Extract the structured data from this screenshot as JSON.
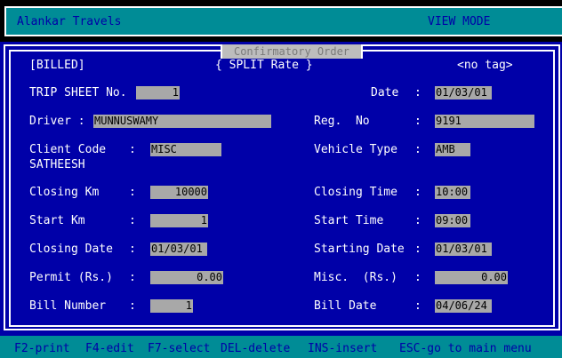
{
  "app": {
    "title": "Alankar Travels",
    "mode": "VIEW MODE"
  },
  "form": {
    "title": "Confirmatory Order",
    "status": "[BILLED]",
    "rate_type": "{ SPLIT Rate }",
    "tag": "<no tag>"
  },
  "fields": {
    "trip_sheet_label": "TRIP SHEET No.",
    "trip_sheet_value": "1",
    "date_label": "Date",
    "date_colon": ":",
    "date_value": "01/03/01",
    "driver_label": "Driver :",
    "driver_value": "MUNNUSWAMY",
    "reg_label": "Reg.  No",
    "reg_colon": ":",
    "reg_value": "9191",
    "client_label": "Client Code",
    "client_colon": ":",
    "client_value": "MISC",
    "client_name": "SATHEESH",
    "vehicle_label": "Vehicle Type",
    "vehicle_colon": ":",
    "vehicle_value": "AMB",
    "closing_km_label": "Closing Km",
    "closing_km_colon": ":",
    "closing_km_value": "10000",
    "closing_time_label": "Closing Time",
    "closing_time_colon": ":",
    "closing_time_value": "10:00",
    "start_km_label": "Start Km",
    "start_km_colon": ":",
    "start_km_value": "1",
    "start_time_label": "Start Time",
    "start_time_colon": ":",
    "start_time_value": "09:00",
    "closing_date_label": "Closing Date",
    "closing_date_colon": ":",
    "closing_date_value": "01/03/01",
    "starting_date_label": "Starting Date",
    "starting_date_colon": ":",
    "starting_date_value": "01/03/01",
    "permit_label": "Permit (Rs.)",
    "permit_colon": ":",
    "permit_value": "0.00",
    "misc_label": "Misc.  (Rs.)",
    "misc_colon": ":",
    "misc_value": "0.00",
    "bill_number_label": "Bill Number",
    "bill_number_colon": ":",
    "bill_number_value": "1",
    "bill_date_label": "Bill Date",
    "bill_date_colon": ":",
    "bill_date_value": "04/06/24"
  },
  "footer": {
    "print": "F2-print",
    "edit": "F4-edit",
    "select": "F7-select",
    "delete": "DEL-delete",
    "insert": "INS-insert",
    "escape": "ESC-go to main menu"
  },
  "colors": {
    "background": "#0000a8",
    "accent": "#008c96",
    "field": "#a8a8a8",
    "text": "#ffffff"
  }
}
